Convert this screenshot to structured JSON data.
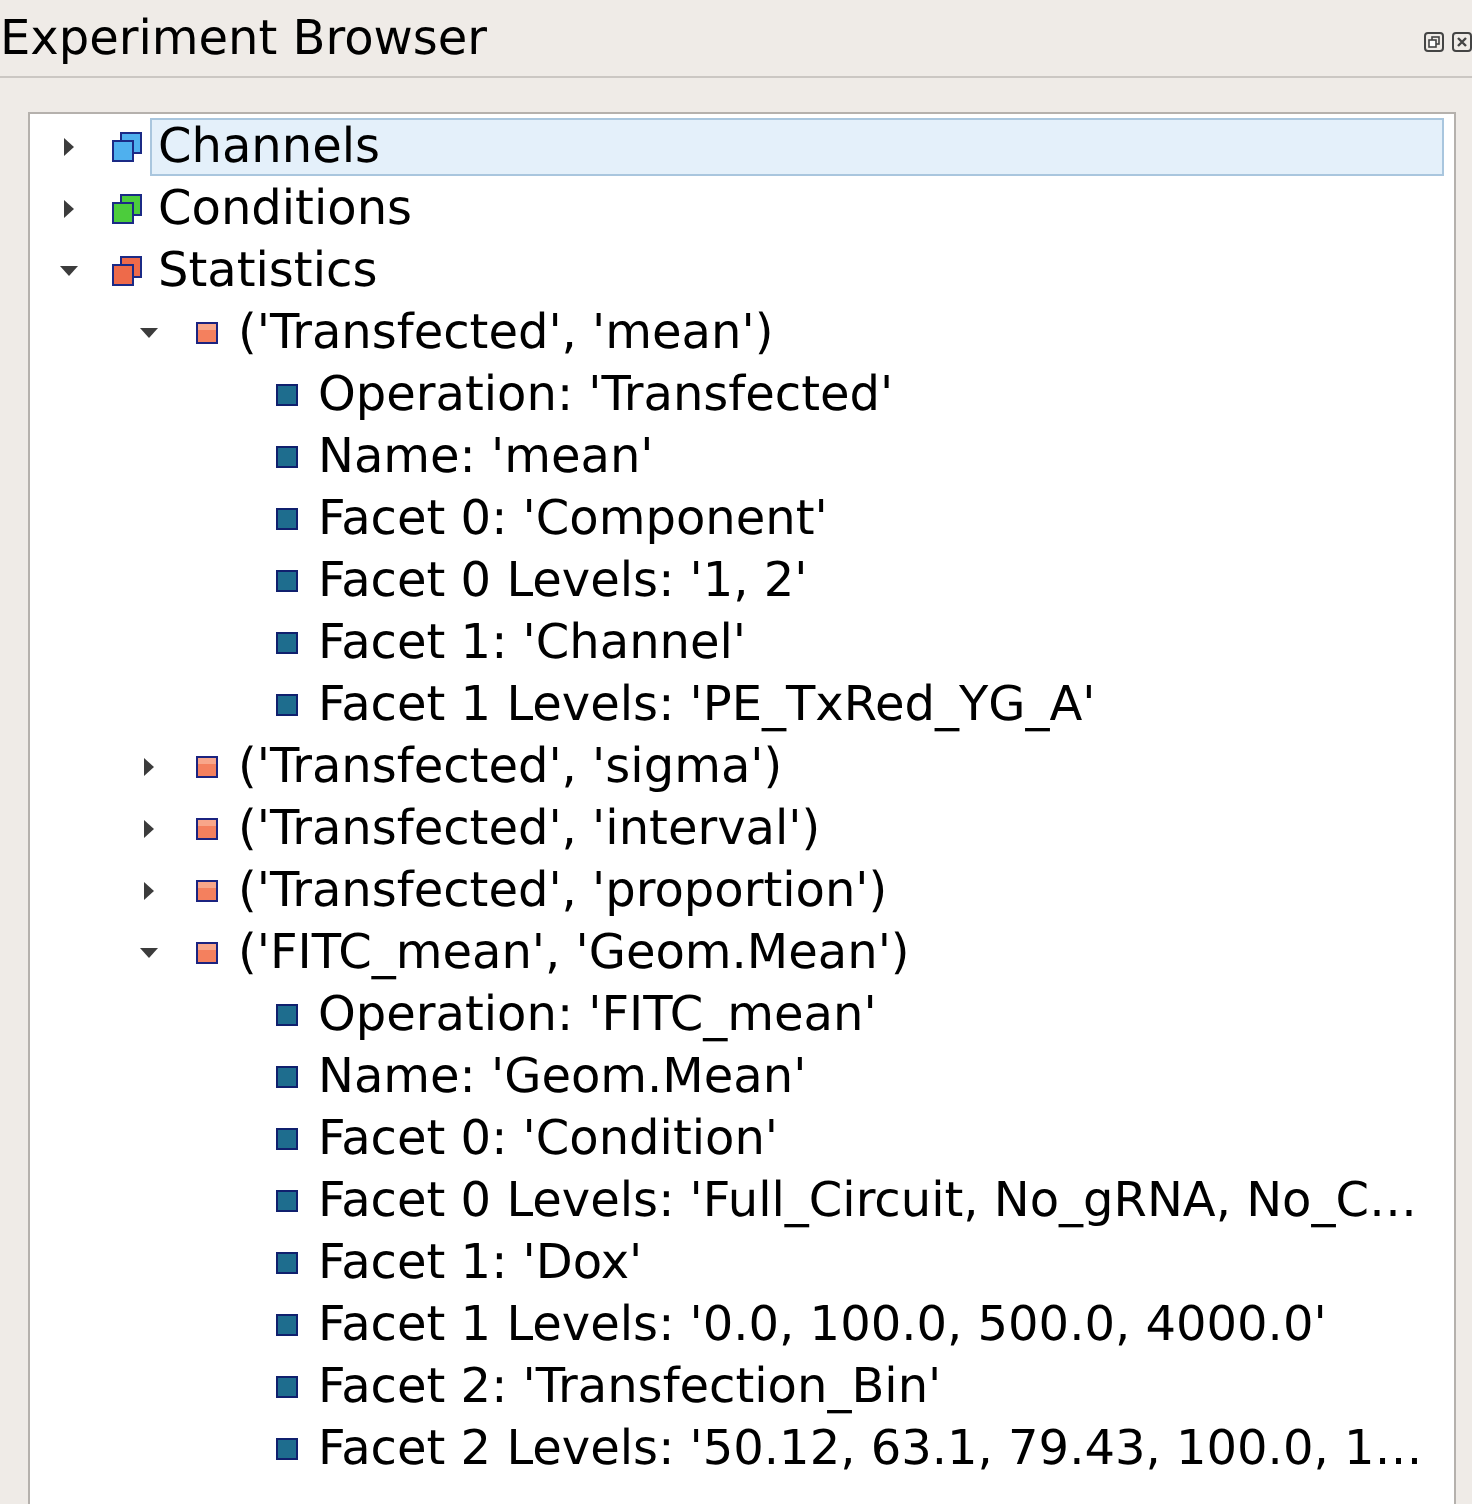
{
  "window": {
    "title": "Experiment Browser"
  },
  "tree": {
    "items": [
      {
        "label": "Channels",
        "color": "#4fb0ee",
        "expanded": false,
        "selected": true
      },
      {
        "label": "Conditions",
        "color": "#4ccc3c",
        "expanded": false,
        "selected": false
      },
      {
        "label": "Statistics",
        "color": "#ee6a4a",
        "expanded": true,
        "selected": false,
        "children": [
          {
            "label": "('Transfected', 'mean')",
            "expanded": true,
            "selected": false,
            "children": [
              {
                "label": "Operation: 'Transfected'",
                "selected": false
              },
              {
                "label": "Name: 'mean'",
                "selected": false
              },
              {
                "label": "Facet 0: 'Component'",
                "selected": false
              },
              {
                "label": "Facet 0 Levels: '1, 2'",
                "selected": false
              },
              {
                "label": "Facet 1: 'Channel'",
                "selected": false
              },
              {
                "label": "Facet 1 Levels: 'PE_TxRed_YG_A'",
                "selected": false
              }
            ]
          },
          {
            "label": "('Transfected', 'sigma')",
            "expanded": false,
            "selected": false
          },
          {
            "label": "('Transfected', 'interval')",
            "expanded": false,
            "selected": false
          },
          {
            "label": "('Transfected', 'proportion')",
            "expanded": false,
            "selected": false
          },
          {
            "label": "('FITC_mean', 'Geom.Mean')",
            "expanded": true,
            "selected": false,
            "children": [
              {
                "label": "Operation: 'FITC_mean'",
                "selected": false
              },
              {
                "label": "Name: 'Geom.Mean'",
                "selected": false
              },
              {
                "label": "Facet 0: 'Condition'",
                "selected": false
              },
              {
                "label": "Facet 0 Levels: 'Full_Circuit, No_gRNA, No_C…",
                "selected": false
              },
              {
                "label": "Facet 1: 'Dox'",
                "selected": false
              },
              {
                "label": "Facet 1 Levels: '0.0, 100.0, 500.0, 4000.0'",
                "selected": false
              },
              {
                "label": "Facet 2: 'Transfection_Bin'",
                "selected": false
              },
              {
                "label": "Facet 2 Levels: '50.12, 63.1, 79.43, 100.0, 1…",
                "selected": false
              }
            ]
          }
        ]
      }
    ]
  }
}
